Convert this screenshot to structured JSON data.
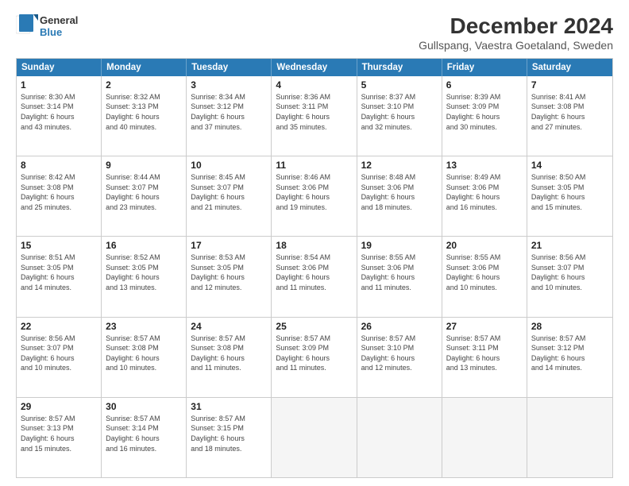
{
  "logo": {
    "general": "General",
    "blue": "Blue"
  },
  "title": "December 2024",
  "subtitle": "Gullspang, Vaestra Goetaland, Sweden",
  "calendar": {
    "headers": [
      "Sunday",
      "Monday",
      "Tuesday",
      "Wednesday",
      "Thursday",
      "Friday",
      "Saturday"
    ],
    "rows": [
      [
        {
          "day": "1",
          "info": "Sunrise: 8:30 AM\nSunset: 3:14 PM\nDaylight: 6 hours\nand 43 minutes."
        },
        {
          "day": "2",
          "info": "Sunrise: 8:32 AM\nSunset: 3:13 PM\nDaylight: 6 hours\nand 40 minutes."
        },
        {
          "day": "3",
          "info": "Sunrise: 8:34 AM\nSunset: 3:12 PM\nDaylight: 6 hours\nand 37 minutes."
        },
        {
          "day": "4",
          "info": "Sunrise: 8:36 AM\nSunset: 3:11 PM\nDaylight: 6 hours\nand 35 minutes."
        },
        {
          "day": "5",
          "info": "Sunrise: 8:37 AM\nSunset: 3:10 PM\nDaylight: 6 hours\nand 32 minutes."
        },
        {
          "day": "6",
          "info": "Sunrise: 8:39 AM\nSunset: 3:09 PM\nDaylight: 6 hours\nand 30 minutes."
        },
        {
          "day": "7",
          "info": "Sunrise: 8:41 AM\nSunset: 3:08 PM\nDaylight: 6 hours\nand 27 minutes."
        }
      ],
      [
        {
          "day": "8",
          "info": "Sunrise: 8:42 AM\nSunset: 3:08 PM\nDaylight: 6 hours\nand 25 minutes."
        },
        {
          "day": "9",
          "info": "Sunrise: 8:44 AM\nSunset: 3:07 PM\nDaylight: 6 hours\nand 23 minutes."
        },
        {
          "day": "10",
          "info": "Sunrise: 8:45 AM\nSunset: 3:07 PM\nDaylight: 6 hours\nand 21 minutes."
        },
        {
          "day": "11",
          "info": "Sunrise: 8:46 AM\nSunset: 3:06 PM\nDaylight: 6 hours\nand 19 minutes."
        },
        {
          "day": "12",
          "info": "Sunrise: 8:48 AM\nSunset: 3:06 PM\nDaylight: 6 hours\nand 18 minutes."
        },
        {
          "day": "13",
          "info": "Sunrise: 8:49 AM\nSunset: 3:06 PM\nDaylight: 6 hours\nand 16 minutes."
        },
        {
          "day": "14",
          "info": "Sunrise: 8:50 AM\nSunset: 3:05 PM\nDaylight: 6 hours\nand 15 minutes."
        }
      ],
      [
        {
          "day": "15",
          "info": "Sunrise: 8:51 AM\nSunset: 3:05 PM\nDaylight: 6 hours\nand 14 minutes."
        },
        {
          "day": "16",
          "info": "Sunrise: 8:52 AM\nSunset: 3:05 PM\nDaylight: 6 hours\nand 13 minutes."
        },
        {
          "day": "17",
          "info": "Sunrise: 8:53 AM\nSunset: 3:05 PM\nDaylight: 6 hours\nand 12 minutes."
        },
        {
          "day": "18",
          "info": "Sunrise: 8:54 AM\nSunset: 3:06 PM\nDaylight: 6 hours\nand 11 minutes."
        },
        {
          "day": "19",
          "info": "Sunrise: 8:55 AM\nSunset: 3:06 PM\nDaylight: 6 hours\nand 11 minutes."
        },
        {
          "day": "20",
          "info": "Sunrise: 8:55 AM\nSunset: 3:06 PM\nDaylight: 6 hours\nand 10 minutes."
        },
        {
          "day": "21",
          "info": "Sunrise: 8:56 AM\nSunset: 3:07 PM\nDaylight: 6 hours\nand 10 minutes."
        }
      ],
      [
        {
          "day": "22",
          "info": "Sunrise: 8:56 AM\nSunset: 3:07 PM\nDaylight: 6 hours\nand 10 minutes."
        },
        {
          "day": "23",
          "info": "Sunrise: 8:57 AM\nSunset: 3:08 PM\nDaylight: 6 hours\nand 10 minutes."
        },
        {
          "day": "24",
          "info": "Sunrise: 8:57 AM\nSunset: 3:08 PM\nDaylight: 6 hours\nand 11 minutes."
        },
        {
          "day": "25",
          "info": "Sunrise: 8:57 AM\nSunset: 3:09 PM\nDaylight: 6 hours\nand 11 minutes."
        },
        {
          "day": "26",
          "info": "Sunrise: 8:57 AM\nSunset: 3:10 PM\nDaylight: 6 hours\nand 12 minutes."
        },
        {
          "day": "27",
          "info": "Sunrise: 8:57 AM\nSunset: 3:11 PM\nDaylight: 6 hours\nand 13 minutes."
        },
        {
          "day": "28",
          "info": "Sunrise: 8:57 AM\nSunset: 3:12 PM\nDaylight: 6 hours\nand 14 minutes."
        }
      ],
      [
        {
          "day": "29",
          "info": "Sunrise: 8:57 AM\nSunset: 3:13 PM\nDaylight: 6 hours\nand 15 minutes."
        },
        {
          "day": "30",
          "info": "Sunrise: 8:57 AM\nSunset: 3:14 PM\nDaylight: 6 hours\nand 16 minutes."
        },
        {
          "day": "31",
          "info": "Sunrise: 8:57 AM\nSunset: 3:15 PM\nDaylight: 6 hours\nand 18 minutes."
        },
        {
          "day": "",
          "info": ""
        },
        {
          "day": "",
          "info": ""
        },
        {
          "day": "",
          "info": ""
        },
        {
          "day": "",
          "info": ""
        }
      ]
    ]
  }
}
